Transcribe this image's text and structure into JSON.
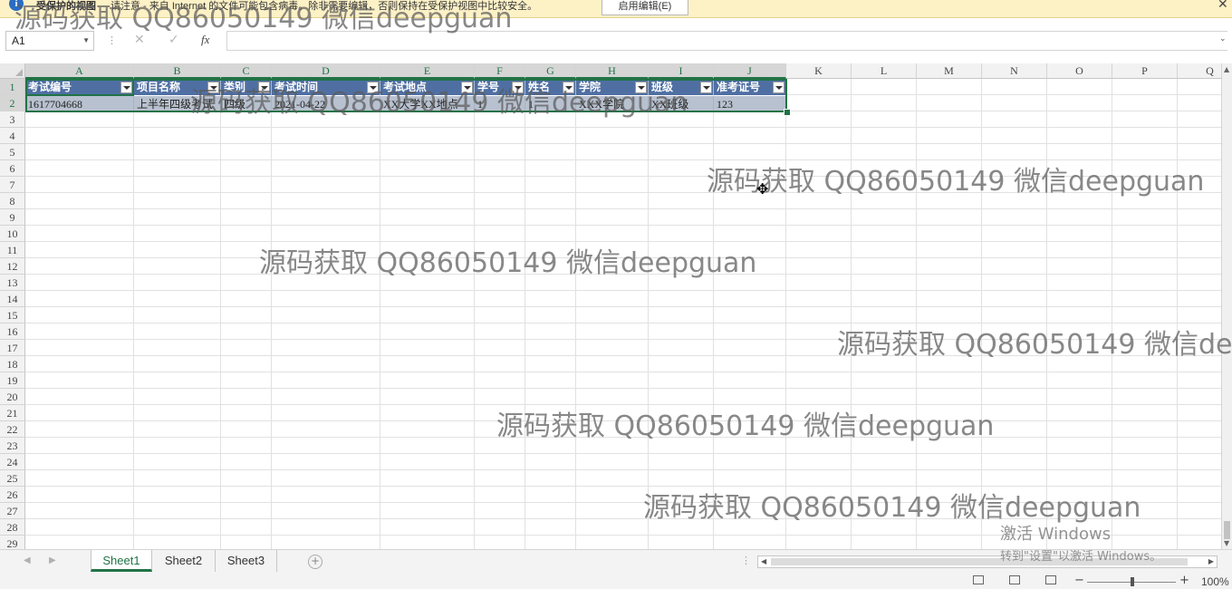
{
  "protected_view": {
    "icon": "info-icon",
    "title": "受保护的视图",
    "message": "请注意 - 来自 Internet 的文件可能包含病毒。除非需要编辑，否则保持在受保护视图中比较安全。",
    "enable_button": "启用编辑(E)",
    "close": "✕"
  },
  "formula_bar": {
    "name_box": "A1",
    "cancel_icon": "✕",
    "enter_icon": "✓",
    "fx": "fx",
    "value": ""
  },
  "columns": [
    "A",
    "B",
    "C",
    "D",
    "E",
    "F",
    "G",
    "H",
    "I",
    "J",
    "K",
    "L",
    "M",
    "N",
    "O",
    "P",
    "Q"
  ],
  "rows": [
    "1",
    "2",
    "3",
    "4",
    "5",
    "6",
    "7",
    "8",
    "9",
    "10",
    "11",
    "12",
    "13",
    "14",
    "15",
    "16",
    "17",
    "18",
    "19",
    "20",
    "21",
    "22",
    "23",
    "24",
    "25",
    "26",
    "27",
    "28",
    "29"
  ],
  "table": {
    "headers": [
      "考试编号",
      "项目名称",
      "类别",
      "考试时间",
      "考试地点",
      "学号",
      "姓名",
      "学院",
      "班级",
      "准考证号"
    ],
    "row": [
      "1617704668",
      "上半年四级考试",
      "四级",
      "2021-04-22",
      "XX大学XX地点",
      "1",
      "1",
      "XXX学院",
      "XX班级",
      "123"
    ]
  },
  "watermark": "源码获取 QQ86050149 微信deepguan",
  "sheets": [
    "Sheet1",
    "Sheet2",
    "Sheet3"
  ],
  "active_sheet": "Sheet1",
  "activation": {
    "line1": "激活 Windows",
    "line2": "转到\"设置\"以激活 Windows。"
  },
  "status": {
    "zoom": "100%",
    "zoom_level": 1.0
  },
  "colors": {
    "accent": "#217346",
    "table_header": "#4f6fa3",
    "table_row": "#b8c1cf",
    "protected_bar": "#fdf1c6"
  }
}
